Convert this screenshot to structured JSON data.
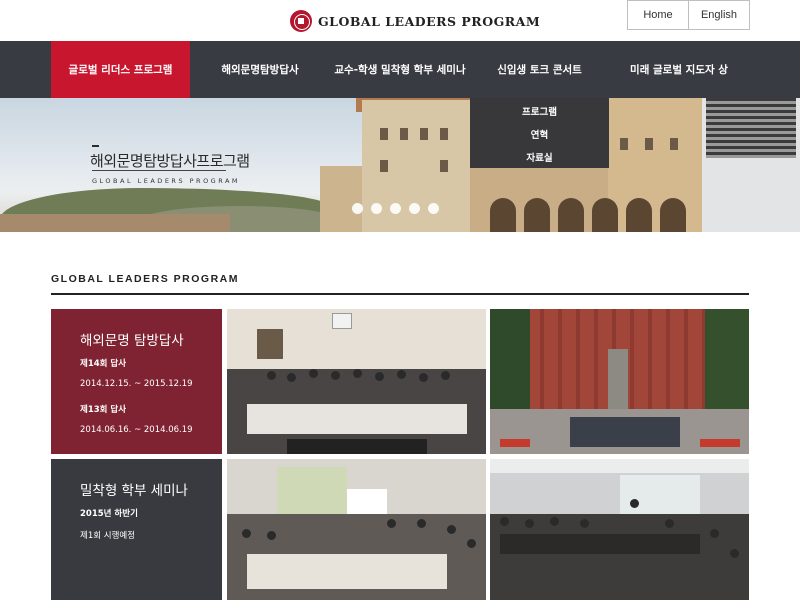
{
  "header": {
    "logo_text": "GLOBAL LEADERS PROGRAM",
    "lang_links": {
      "home": "Home",
      "english": "English"
    }
  },
  "nav": {
    "items": [
      "글로벌 리더스 프로그램",
      "해외문명탐방답사",
      "교수-학생 밀착형 학부 세미나",
      "신입생 토크 콘서트",
      "미래 글로벌 지도자 상"
    ],
    "active_index": 0,
    "dropdown": [
      "프로그램",
      "연혁",
      "자료실"
    ]
  },
  "hero": {
    "title": "해외문명탐방답사프로그램",
    "subtitle": "GLOBAL LEADERS PROGRAM",
    "slide_dots": 5
  },
  "section": {
    "title": "GLOBAL LEADERS PROGRAM"
  },
  "cards": [
    {
      "title": "해외문명 탐방답사",
      "entries": [
        {
          "label": "제14회 답사",
          "date": "2014.12.15. ~ 2015.12.19"
        },
        {
          "label": "제13회 답사",
          "date": "2014.06.16. ~ 2014.06.19"
        }
      ]
    },
    {
      "title": "밀착형 학부 세미나",
      "entries": [
        {
          "label": "2015년 하반기",
          "date": "제1회 시행예정"
        }
      ]
    }
  ],
  "colors": {
    "nav_bg": "#393b43",
    "accent_red": "#c9162f",
    "card_burgundy": "#7f2333",
    "card_dark": "#383a3f"
  }
}
